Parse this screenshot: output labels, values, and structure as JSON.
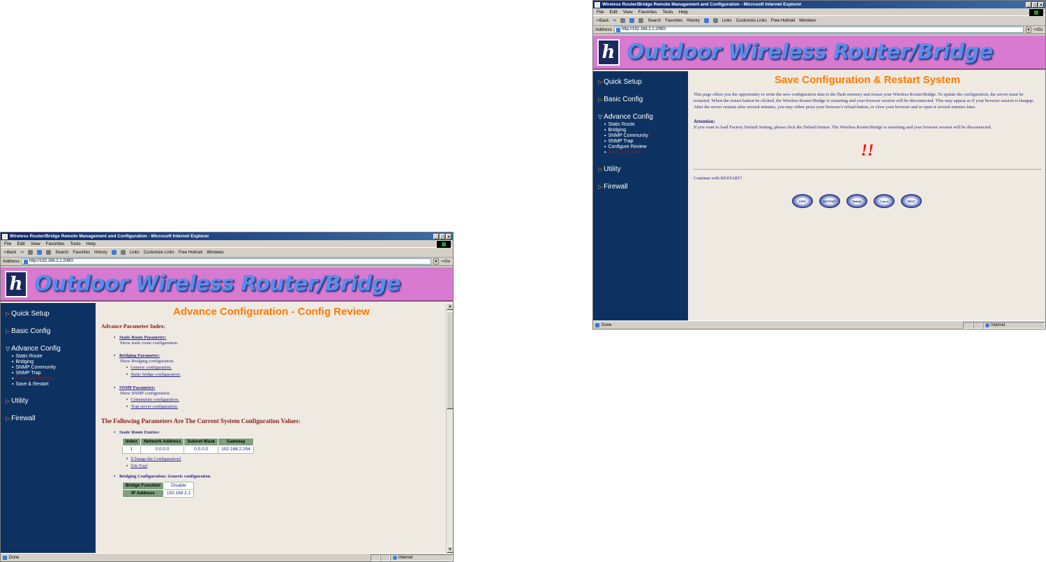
{
  "browser": {
    "window_title": "Wireless Router/Bridge Remote Management and Configuration - Microsoft Internet Explorer",
    "menu": [
      "File",
      "Edit",
      "View",
      "Favorites",
      "Tools",
      "Help"
    ],
    "toolbar": {
      "back": "Back",
      "search": "Search",
      "favorites": "Favorites",
      "history": "History",
      "links": "Links",
      "link_1": "Customize Links",
      "link_2": "Free Hotmail",
      "link_3": "Windows"
    },
    "address_label": "Address",
    "address_value": "http://192.168.2.1:2080/",
    "go": "Go",
    "status_left": "Done",
    "status_zone": "Internet"
  },
  "banner": {
    "logo": "h",
    "title": "Outdoor Wireless Router/Bridge"
  },
  "nav": {
    "quick_setup": "Quick Setup",
    "basic_config": "Basic Config",
    "advance_config": "Advance Config",
    "utility": "Utility",
    "firewall": "Firewall",
    "sub_left": [
      "Static Route",
      "Bridging",
      "SNMP Community",
      "SNMP Trap",
      "Configure Review",
      "Save & Restart"
    ],
    "sub_right": [
      "Static Route",
      "Bridging",
      "SNMP Community",
      "SNMP Trap",
      "Configure Review",
      "Save & Restart"
    ]
  },
  "left_page": {
    "title": "Advance Configuration - Config Review",
    "index_heading": "Advance Parameter Index:",
    "static_route_link": "Static Route Parameter:",
    "static_route_desc": "Show static route configuration.",
    "bridging_link": "Bridging Parameter:",
    "bridging_desc": "Show Bridging configuration.",
    "bridging_sub": [
      "Generic configuration.",
      "Static bridge configuration."
    ],
    "snmp_link": "SNMP Parameter:",
    "snmp_desc": "Show SNMP configuration.",
    "snmp_sub": [
      "Community configuration.",
      "Trap server configuration."
    ],
    "current_heading": "The Following Parameters Are The Current System Configuration Values:",
    "static_entries_label": "Static Route Entries:",
    "route_table": {
      "headers": [
        "Index",
        "Network Address",
        "Subnet Mask",
        "Gateway"
      ],
      "rows": [
        [
          "1",
          "0.0.0.0",
          "0.0.0.0",
          "192.168.2.254"
        ]
      ]
    },
    "change_link": "[Change the Configuration]",
    "top_link": "[On Top]",
    "bridging_generic_label": "Bridging Configuration: Generic configuration",
    "bridge_table": [
      {
        "label": "Bridge Function",
        "value": "Disable"
      },
      {
        "label": "IP Address",
        "value": "192.168.2.1"
      }
    ]
  },
  "right_page": {
    "title": "Save Configuration & Restart System",
    "intro": "This page offers you the opportunity to write the new configuration data to the flash memory and restart your Wireless Router/Bridge. To update the configuration, the server must be restarted. When the restart button be clicked, the Wireless Router/Bridge is restarting and your browser session will be disconnected. This may appear as if your browser session is hungup. After the server restarts after several minutes, you may either press your browser's reload button, or close your browser and re-open it several minutes later.",
    "attention_label": "Attention:",
    "attention_text": "If you want to load Factory Default Setting, please click the Default button. The Wireless Router/Bridge is restarting and your browser session will be disconnected.",
    "warning_mark": "!!",
    "continue_text": "Continue with RESTART?",
    "buttons": [
      "SAVE",
      "RESTART",
      "Default",
      "Cancel",
      "HELP"
    ]
  }
}
